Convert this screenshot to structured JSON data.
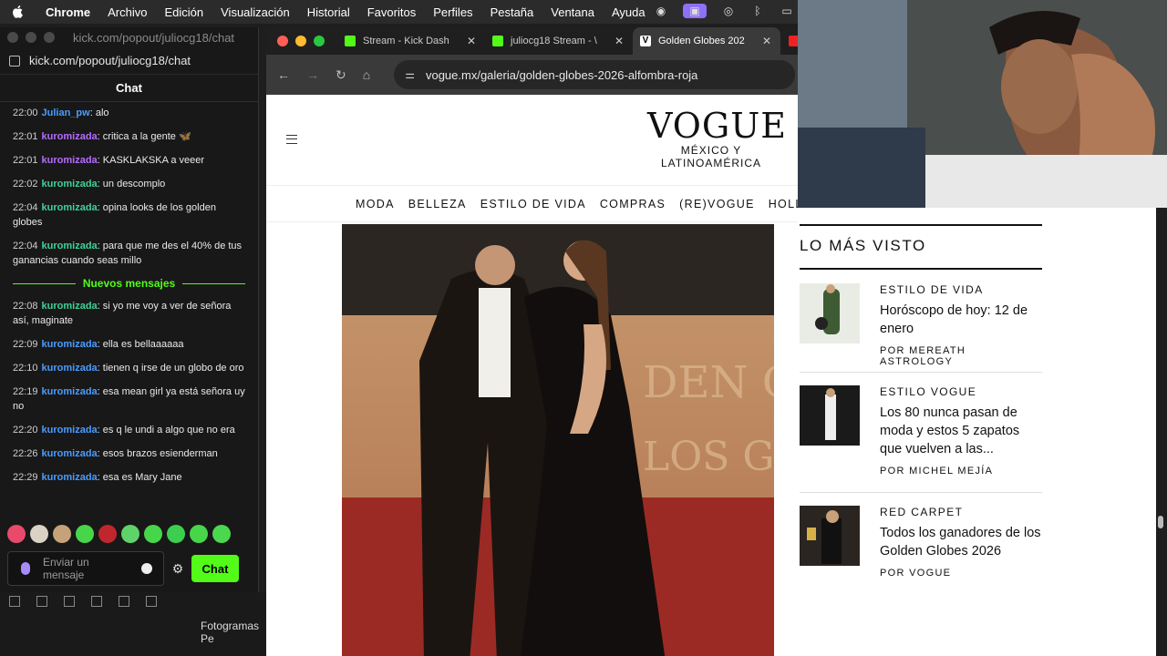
{
  "menubar": {
    "app": "Chrome",
    "items": [
      "Archivo",
      "Edición",
      "Visualización",
      "Historial",
      "Favoritos",
      "Perfiles",
      "Pestaña",
      "Ventana",
      "Ayuda"
    ]
  },
  "chat_window": {
    "titlebar_url": "kick.com/popout/juliocg18/chat",
    "address": "kick.com/popout/juliocg18/chat",
    "header": "Chat",
    "messages_before": [
      {
        "time": "22:00",
        "user": "Julian_pw",
        "color": "#4a9cff",
        "text": ": alo"
      },
      {
        "time": "22:01",
        "user": "kuromizada",
        "color": "#b56cff",
        "text": ": critica a la gente 🦋"
      },
      {
        "time": "22:01",
        "user": "kuromizada",
        "color": "#b56cff",
        "text": ": KASKLAKSKA a veeer"
      },
      {
        "time": "22:02",
        "user": "kuromizada",
        "color": "#3fd19a",
        "text": ": un descomplo"
      },
      {
        "time": "22:04",
        "user": "kuromizada",
        "color": "#3fd19a",
        "text": ": opina looks de los golden globes"
      },
      {
        "time": "22:04",
        "user": "kuromizada",
        "color": "#3fd19a",
        "text": ": para que me des el 40% de tus ganancias cuando seas millo"
      }
    ],
    "new_messages_label": "Nuevos mensajes",
    "messages_after": [
      {
        "time": "22:08",
        "user": "kuromizada",
        "color": "#3fd19a",
        "text": ": si yo me voy a ver de señora así, maginate"
      },
      {
        "time": "22:09",
        "user": "kuromizada",
        "color": "#4a9cff",
        "text": ": ella es bellaaaaaa"
      },
      {
        "time": "22:10",
        "user": "kuromizada",
        "color": "#4a9cff",
        "text": ": tienen q irse de un globo de oro"
      },
      {
        "time": "22:19",
        "user": "kuromizada",
        "color": "#4a9cff",
        "text": ": esa mean girl ya está señora uy no"
      },
      {
        "time": "22:20",
        "user": "kuromizada",
        "color": "#4a9cff",
        "text": ": es q le undi a algo que no era"
      },
      {
        "time": "22:26",
        "user": "kuromizada",
        "color": "#4a9cff",
        "text": ": esos brazos esienderman"
      },
      {
        "time": "22:29",
        "user": "kuromizada",
        "color": "#4a9cff",
        "text": ": esa es Mary Jane"
      }
    ],
    "input_placeholder": "Enviar un mensaje",
    "send_label": "Chat",
    "footer_text": "Fotogramas Pe"
  },
  "browser": {
    "tabs": [
      {
        "label": "Stream - Kick Dash",
        "active": false
      },
      {
        "label": "juliocg18 Stream - \\",
        "active": false
      },
      {
        "label": "Golden Globes 202",
        "active": true
      }
    ],
    "url": "vogue.mx/galeria/golden-globes-2026-alfombra-roja"
  },
  "vogue": {
    "logo": "VOGUE",
    "logo_sub_1": "MÉXICO Y",
    "logo_sub_2": "LATINOAMÉRICA",
    "nav": [
      "MODA",
      "BELLEZA",
      "ESTILO DE VIDA",
      "COMPRAS",
      "(RE)VOGUE",
      "HOLLYWO"
    ]
  },
  "sidebar": {
    "heading": "LO MÁS VISTO",
    "items": [
      {
        "category": "ESTILO DE VIDA",
        "title": "Horóscopo de hoy: 12 de enero",
        "byline": "POR MEREATH ASTROLOGY"
      },
      {
        "category": "ESTILO VOGUE",
        "title": "Los 80 nunca pasan de moda y estos 5 zapatos que vuelven a las...",
        "byline": "POR MICHEL MEJÍA"
      },
      {
        "category": "RED CARPET",
        "title": "Todos los ganadores de los Golden Globes 2026",
        "byline": "POR VOGUE"
      }
    ]
  }
}
